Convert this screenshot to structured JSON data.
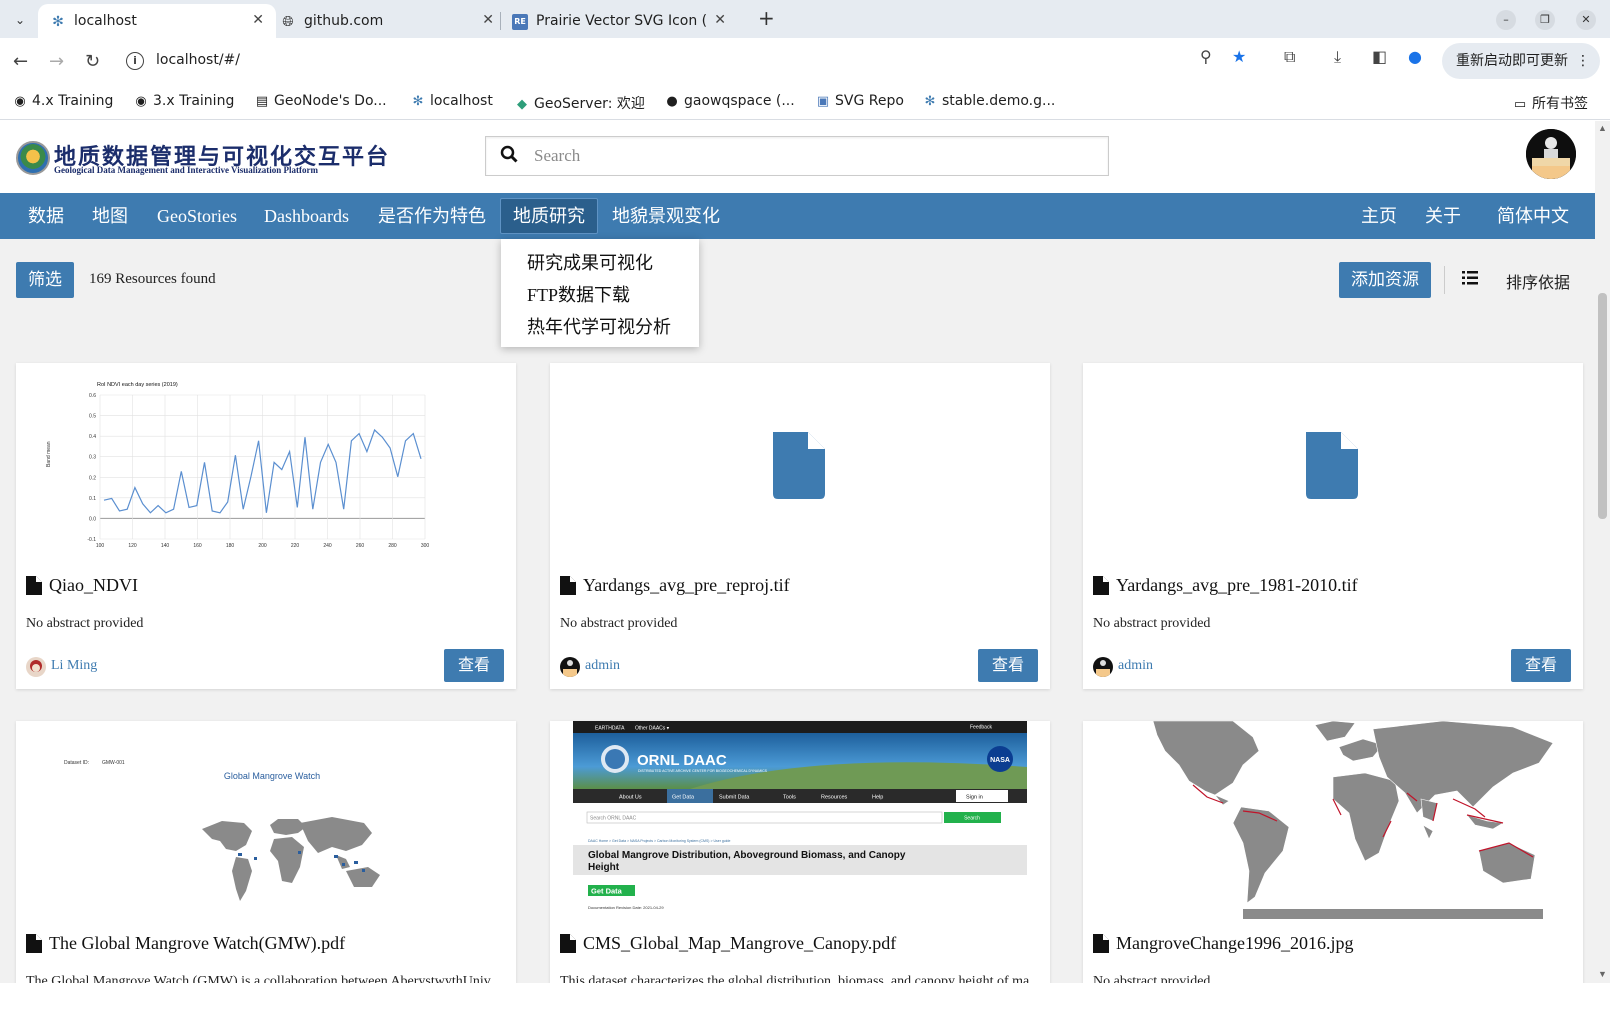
{
  "browser": {
    "tabs": [
      {
        "title": "localhost",
        "icon": "geonode-icon"
      },
      {
        "title": "github.com",
        "icon": "globe-icon"
      },
      {
        "title": "Prairie Vector SVG Icon (",
        "icon": "svgrepo-icon"
      }
    ],
    "url": "localhost/#/",
    "update_button": "重新启动即可更新",
    "bookmarks": [
      {
        "label": "4.x Training"
      },
      {
        "label": "3.x Training"
      },
      {
        "label": "GeoNode's Do..."
      },
      {
        "label": "localhost"
      },
      {
        "label": "GeoServer: 欢迎"
      },
      {
        "label": "gaowqspace (..."
      },
      {
        "label": "SVG Repo"
      },
      {
        "label": "stable.demo.g..."
      }
    ],
    "all_bookmarks": "所有书签"
  },
  "header": {
    "logo_title": "地质数据管理与可视化交互平台",
    "logo_subtitle": "Geological Data Management and Interactive Visualization Platform",
    "search_placeholder": "Search"
  },
  "menu": {
    "left": [
      "数据",
      "地图",
      "GeoStories",
      "Dashboards",
      "是否作为特色",
      "地质研究",
      "地貌景观变化"
    ],
    "right": [
      "主页",
      "关于",
      "简体中文"
    ],
    "active": "地质研究",
    "dropdown": [
      "研究成果可视化",
      "FTP数据下载",
      "热年代学可视分析"
    ]
  },
  "toolbar": {
    "filter_label": "筛选",
    "count_text": "169 Resources found",
    "add_label": "添加资源",
    "sort_label": "排序依据"
  },
  "cards": [
    {
      "title": "Qiao_NDVI",
      "abstract": "No abstract provided",
      "owner": "Li Ming",
      "view_label": "查看",
      "thumb": "ndvi-chart"
    },
    {
      "title": "Yardangs_avg_pre_reproj.tif",
      "abstract": "No abstract provided",
      "owner": "admin",
      "view_label": "查看",
      "thumb": "file-placeholder"
    },
    {
      "title": "Yardangs_avg_pre_1981-2010.tif",
      "abstract": "No abstract provided",
      "owner": "admin",
      "view_label": "查看",
      "thumb": "file-placeholder"
    },
    {
      "title": "The Global Mangrove Watch(GMW).pdf",
      "abstract": "The Global Mangrove Watch (GMW) is a collaboration between AberystwythUniversity...",
      "thumb": "gmw-map"
    },
    {
      "title": "CMS_Global_Map_Mangrove_Canopy.pdf",
      "abstract": "This dataset characterizes the global distribution, biomass, and canopy height of ma...",
      "thumb": "ornl-page"
    },
    {
      "title": "MangroveChange1996_2016.jpg",
      "abstract": "No abstract provided",
      "thumb": "world-map"
    }
  ],
  "thumbs": {
    "ndvi": {
      "title": "RoI NDVI each day series (2019)",
      "ylabel": "Band mean",
      "yticks": [
        "0.6",
        "0.5",
        "0.4",
        "0.3",
        "0.2",
        "0.1",
        "0.0",
        "-0.1"
      ],
      "xticks": [
        "100",
        "120",
        "140",
        "160",
        "180",
        "200",
        "220",
        "240",
        "260",
        "280",
        "300"
      ]
    },
    "gmw": {
      "dataset_id_label": "Dataset ID:",
      "dataset_id": "GMW-001",
      "title": "Global Mangrove Watch"
    },
    "ornl": {
      "topbar_left": "EARTHDATA",
      "topbar_mid": "Other DAACs ▾",
      "topbar_right": "Feedback",
      "logo": "ORNL DAAC",
      "logo_sub": "DISTRIBUTED ACTIVE ARCHIVE CENTER FOR BIOGEOCHEMICAL DYNAMICS",
      "nav": [
        "About Us",
        "Get Data",
        "Submit Data",
        "Tools",
        "Resources",
        "Help"
      ],
      "signin": "Sign in",
      "search_placeholder": "Search ORNL DAAC",
      "search_btn": "Search",
      "breadcrumb": "DAAC Home > Get Data > NASA Projects > Carbon Monitoring System (CMS) > User guide",
      "heading": "Global Mangrove Distribution, Aboveground Biomass, and Canopy Height",
      "get_data": "Get Data",
      "revision": "Documentation Revision Date: 2021-04-29"
    }
  },
  "colors": {
    "primary": "#3e7bb0",
    "menu_active": "#2b5f8c",
    "page_bg": "#f1f1f1",
    "ndvi_line": "#5b8fd0",
    "map_land": "#8a8a8a",
    "mangrove": "#c0142a"
  }
}
